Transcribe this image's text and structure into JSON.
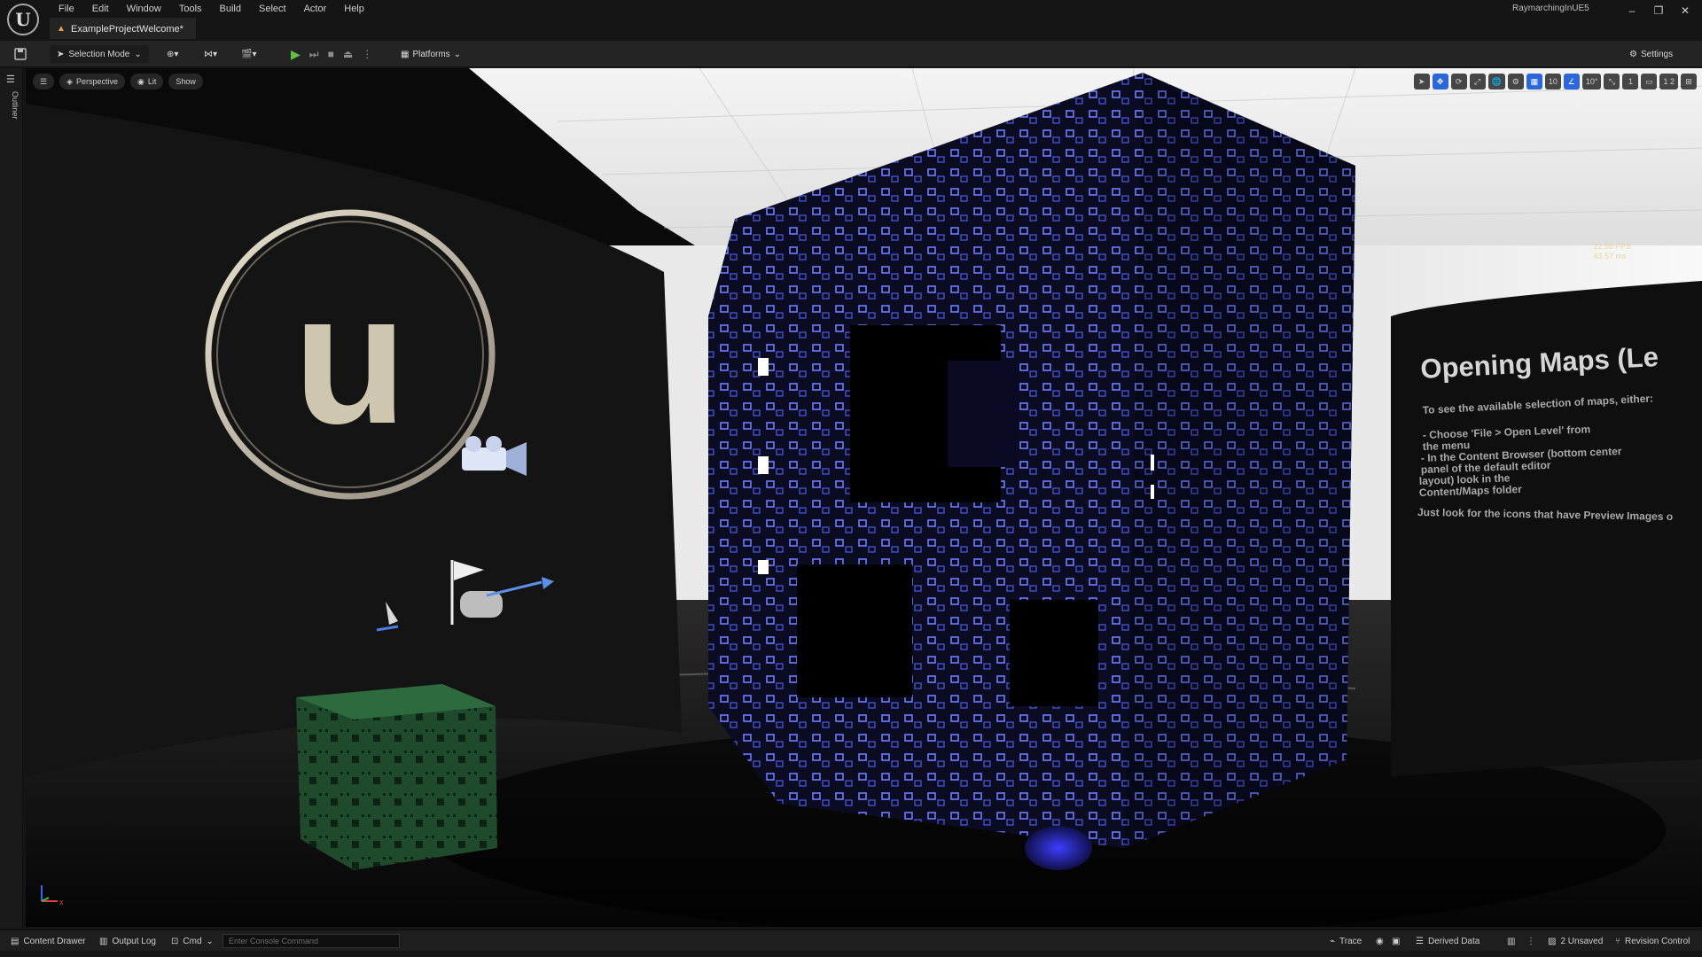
{
  "menu": [
    "File",
    "Edit",
    "Window",
    "Tools",
    "Build",
    "Select",
    "Actor",
    "Help"
  ],
  "tab": {
    "title": "ExampleProjectWelcome*"
  },
  "project_name": "RaymarchingInUE5",
  "window_controls": {
    "minimize": "–",
    "restore": "❐",
    "close": "✕"
  },
  "toolbar": {
    "save_icon": "save-icon",
    "selection_mode": "Selection Mode",
    "platforms": "Platforms",
    "settings": "Settings"
  },
  "sidebar": {
    "outliner": "Outliner"
  },
  "viewport": {
    "perspective": "Perspective",
    "lit": "Lit",
    "show": "Show",
    "grid_snap": "10",
    "rotation_snap": "10°",
    "scale_snap": "1",
    "camera_speed": "1 2",
    "fps": "22.95 FPS",
    "ms": "43.57 ms",
    "sign_title": "Opening Maps (Le",
    "sign_lines": [
      "To see the available selection of maps, either:",
      "- Choose 'File > Open Level' from",
      "the menu",
      "- In the Content Browser (bottom center",
      "panel of the default editor",
      "layout) look in the",
      "Content/Maps folder",
      "Just look for the icons that have Preview Images o"
    ],
    "axis_x": "x"
  },
  "statusbar": {
    "content_drawer": "Content Drawer",
    "output_log": "Output Log",
    "cmd": "Cmd",
    "console_placeholder": "Enter Console Command",
    "trace": "Trace",
    "derived_data": "Derived Data",
    "unsaved": "2 Unsaved",
    "revision_control": "Revision Control"
  }
}
